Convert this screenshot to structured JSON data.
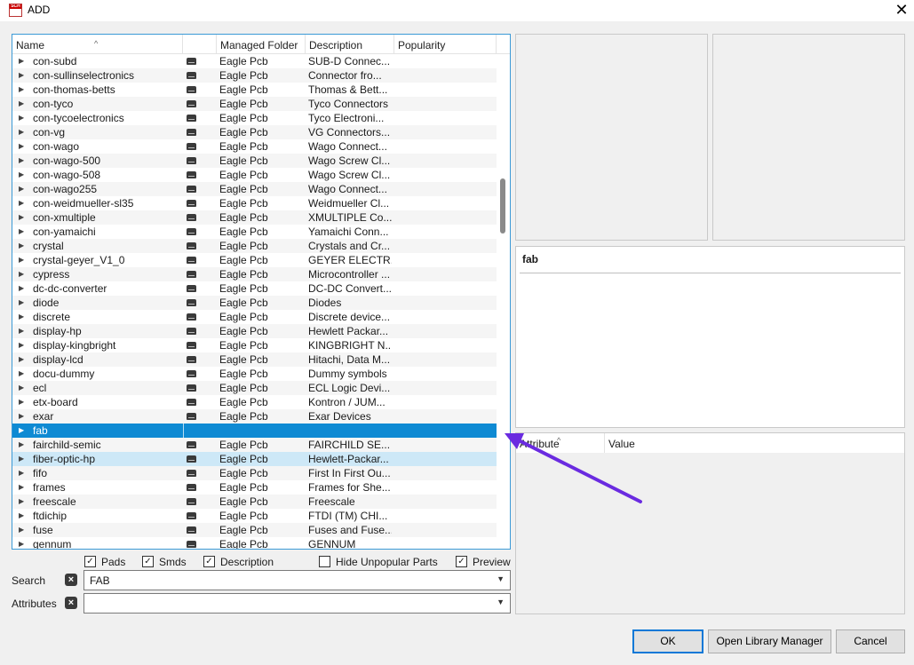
{
  "window": {
    "title": "ADD",
    "icon_label": "SCH",
    "close_glyph": "✕"
  },
  "list": {
    "columns": [
      "Name",
      "",
      "Managed Folder",
      "Description",
      "Popularity"
    ],
    "rows": [
      {
        "name": "con-subd",
        "folder": "Eagle Pcb",
        "desc": "SUB-D Connec..."
      },
      {
        "name": "con-sullinselectronics",
        "folder": "Eagle Pcb",
        "desc": "Connector fro..."
      },
      {
        "name": "con-thomas-betts",
        "folder": "Eagle Pcb",
        "desc": "Thomas & Bett..."
      },
      {
        "name": "con-tyco",
        "folder": "Eagle Pcb",
        "desc": "Tyco Connectors"
      },
      {
        "name": "con-tycoelectronics",
        "folder": "Eagle Pcb",
        "desc": "Tyco Electroni..."
      },
      {
        "name": "con-vg",
        "folder": "Eagle Pcb",
        "desc": "VG Connectors..."
      },
      {
        "name": "con-wago",
        "folder": "Eagle Pcb",
        "desc": "Wago Connect..."
      },
      {
        "name": "con-wago-500",
        "folder": "Eagle Pcb",
        "desc": "Wago Screw Cl..."
      },
      {
        "name": "con-wago-508",
        "folder": "Eagle Pcb",
        "desc": "Wago Screw Cl..."
      },
      {
        "name": "con-wago255",
        "folder": "Eagle Pcb",
        "desc": "Wago Connect..."
      },
      {
        "name": "con-weidmueller-sl35",
        "folder": "Eagle Pcb",
        "desc": "Weidmueller Cl..."
      },
      {
        "name": "con-xmultiple",
        "folder": "Eagle Pcb",
        "desc": "XMULTIPLE Co..."
      },
      {
        "name": "con-yamaichi",
        "folder": "Eagle Pcb",
        "desc": "Yamaichi Conn..."
      },
      {
        "name": "crystal",
        "folder": "Eagle Pcb",
        "desc": "Crystals and Cr..."
      },
      {
        "name": "crystal-geyer_V1_0",
        "folder": "Eagle Pcb",
        "desc": "GEYER ELECTR..."
      },
      {
        "name": "cypress",
        "folder": "Eagle Pcb",
        "desc": "Microcontroller ..."
      },
      {
        "name": "dc-dc-converter",
        "folder": "Eagle Pcb",
        "desc": "DC-DC Convert..."
      },
      {
        "name": "diode",
        "folder": "Eagle Pcb",
        "desc": "Diodes"
      },
      {
        "name": "discrete",
        "folder": "Eagle Pcb",
        "desc": "Discrete device..."
      },
      {
        "name": "display-hp",
        "folder": "Eagle Pcb",
        "desc": "Hewlett Packar..."
      },
      {
        "name": "display-kingbright",
        "folder": "Eagle Pcb",
        "desc": "KINGBRIGHT N..."
      },
      {
        "name": "display-lcd",
        "folder": "Eagle Pcb",
        "desc": "Hitachi, Data M..."
      },
      {
        "name": "docu-dummy",
        "folder": "Eagle Pcb",
        "desc": "Dummy symbols"
      },
      {
        "name": "ecl",
        "folder": "Eagle Pcb",
        "desc": "ECL Logic Devi..."
      },
      {
        "name": "etx-board",
        "folder": "Eagle Pcb",
        "desc": "Kontron / JUM..."
      },
      {
        "name": "exar",
        "folder": "Eagle Pcb",
        "desc": "Exar Devices"
      },
      {
        "name": "fab",
        "folder": "",
        "desc": "",
        "selected": true
      },
      {
        "name": "fairchild-semic",
        "folder": "Eagle Pcb",
        "desc": "FAIRCHILD SE..."
      },
      {
        "name": "fiber-optic-hp",
        "folder": "Eagle Pcb",
        "desc": "Hewlett-Packar...",
        "hover": true
      },
      {
        "name": "fifo",
        "folder": "Eagle Pcb",
        "desc": "First In First Ou..."
      },
      {
        "name": "frames",
        "folder": "Eagle Pcb",
        "desc": "Frames for She..."
      },
      {
        "name": "freescale",
        "folder": "Eagle Pcb",
        "desc": "Freescale"
      },
      {
        "name": "ftdichip",
        "folder": "Eagle Pcb",
        "desc": "FTDI (TM) CHI..."
      },
      {
        "name": "fuse",
        "folder": "Eagle Pcb",
        "desc": "Fuses and Fuse..."
      },
      {
        "name": "gennum",
        "folder": "Eagle Pcb",
        "desc": "GENNUM"
      }
    ]
  },
  "options": {
    "pads": {
      "label": "Pads",
      "checked": true
    },
    "smds": {
      "label": "Smds",
      "checked": true
    },
    "description": {
      "label": "Description",
      "checked": true
    },
    "hide_unpopular": {
      "label": "Hide Unpopular Parts",
      "checked": false
    },
    "preview": {
      "label": "Preview",
      "checked": true
    }
  },
  "search": {
    "label": "Search",
    "value": "FAB"
  },
  "attributes": {
    "label": "Attributes",
    "value": ""
  },
  "info": {
    "title": "fab"
  },
  "attr_table": {
    "columns": [
      "Attribute",
      "Value"
    ]
  },
  "buttons": {
    "ok": "OK",
    "library_manager": "Open Library Manager",
    "cancel": "Cancel"
  },
  "colors": {
    "selection": "#0e8ad3",
    "hover": "#cde8f7",
    "annotation_arrow": "#6a2be0",
    "focus_border": "#3c9ad6"
  }
}
